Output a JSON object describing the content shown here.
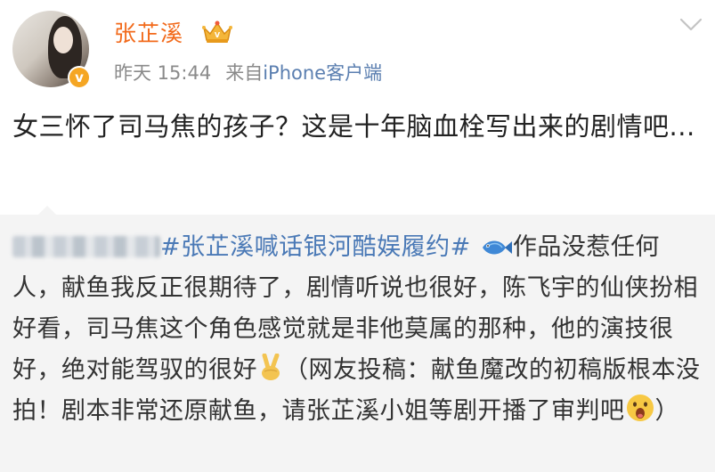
{
  "user": {
    "name": "张芷溪",
    "avatar_icon": "avatar-photo",
    "badge_icon": "verified-icon",
    "badge_color": "#f5a623",
    "crown_icon": "crown-icon",
    "name_color": "#f26a1b"
  },
  "meta": {
    "time": "昨天 15:44",
    "from_label": "来自",
    "client": "iPhone客户端"
  },
  "post": {
    "text": "女三怀了司马焦的孩子？这是十年脑血栓写出来的剧情吧..."
  },
  "repost": {
    "author_blurred": true,
    "hashtag": "#张芷溪喊话银河酷娱履约#",
    "part1": "作品没惹任何人，献鱼我反正很期待了，剧情听说也很好，陈飞宇的仙侠扮相好看，司马焦这个角色感觉就是非他莫属的那种，他的演技很好，绝对能驾驭的很好",
    "part2": "（网友投稿：献鱼魔改的初稿版根本没拍！剧本非常还原献鱼，请张芷溪小姐等剧开播了审判吧",
    "part3": "）",
    "icons": [
      "fish-icon",
      "victory-hand-icon",
      "shocked-face-icon"
    ]
  },
  "colors": {
    "link": "#4a79b6",
    "repost_bg": "#f4f4f4",
    "meta_text": "#8a8a8a"
  }
}
